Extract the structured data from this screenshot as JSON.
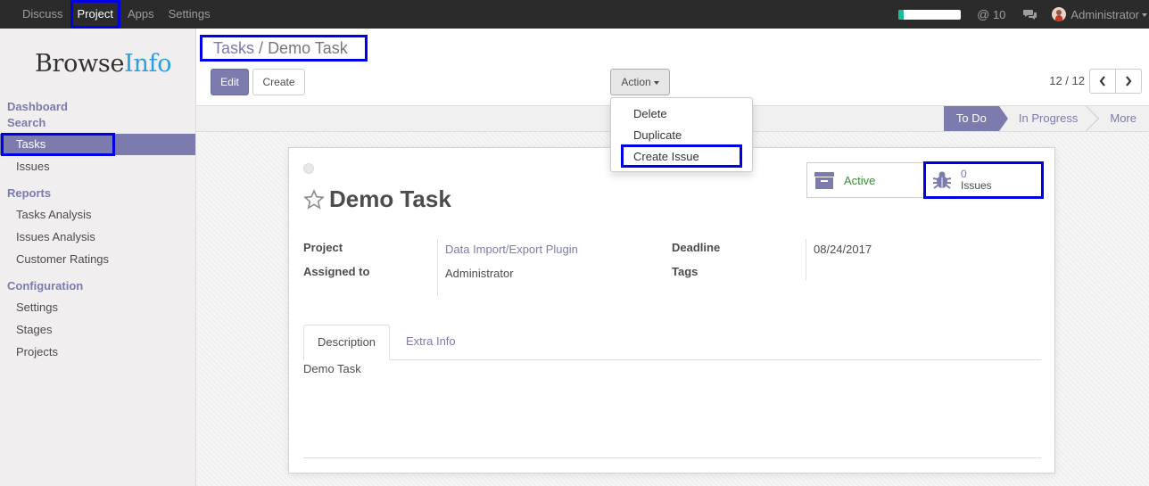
{
  "topbar": {
    "menu": [
      {
        "label": "Discuss",
        "active": false
      },
      {
        "label": "Project",
        "active": true
      },
      {
        "label": "Apps",
        "active": false
      },
      {
        "label": "Settings",
        "active": false
      }
    ],
    "progress_fraction": 0.08,
    "mail_count": "10",
    "user_name": "Administrator"
  },
  "sidebar": {
    "logo_part1": "Browse",
    "logo_part2": "Info",
    "sections": {
      "dashboard": "Dashboard",
      "search": "Search",
      "tasks": "Tasks",
      "issues": "Issues",
      "reports": "Reports",
      "tasks_analysis": "Tasks Analysis",
      "issues_analysis": "Issues Analysis",
      "customer_ratings": "Customer Ratings",
      "configuration": "Configuration",
      "settings": "Settings",
      "stages": "Stages",
      "projects": "Projects"
    }
  },
  "breadcrumb": {
    "parent": "Tasks",
    "separator": "/",
    "current": "Demo Task"
  },
  "buttons": {
    "edit": "Edit",
    "create": "Create",
    "action": "Action"
  },
  "pager": {
    "value": "12 / 12"
  },
  "action_menu": {
    "items": [
      "Delete",
      "Duplicate",
      "Create Issue"
    ]
  },
  "stages": {
    "todo": "To Do",
    "in_progress": "In Progress",
    "more": "More"
  },
  "record": {
    "title": "Demo Task",
    "active_label": "Active",
    "issues_count": "0",
    "issues_label": "Issues",
    "fields": {
      "project_label": "Project",
      "project_value": "Data Import/Export Plugin",
      "assigned_label": "Assigned to",
      "assigned_value": "Administrator",
      "deadline_label": "Deadline",
      "deadline_value": "08/24/2017",
      "tags_label": "Tags"
    },
    "tabs": {
      "description": "Description",
      "extra_info": "Extra Info"
    },
    "description_text": "Demo Task"
  },
  "colors": {
    "accent": "#7c7bad",
    "topbar": "#2b2b2b",
    "highlight": "#0000e6",
    "logo_blue": "#2a9fe0",
    "active_green": "#3a8c3a"
  }
}
